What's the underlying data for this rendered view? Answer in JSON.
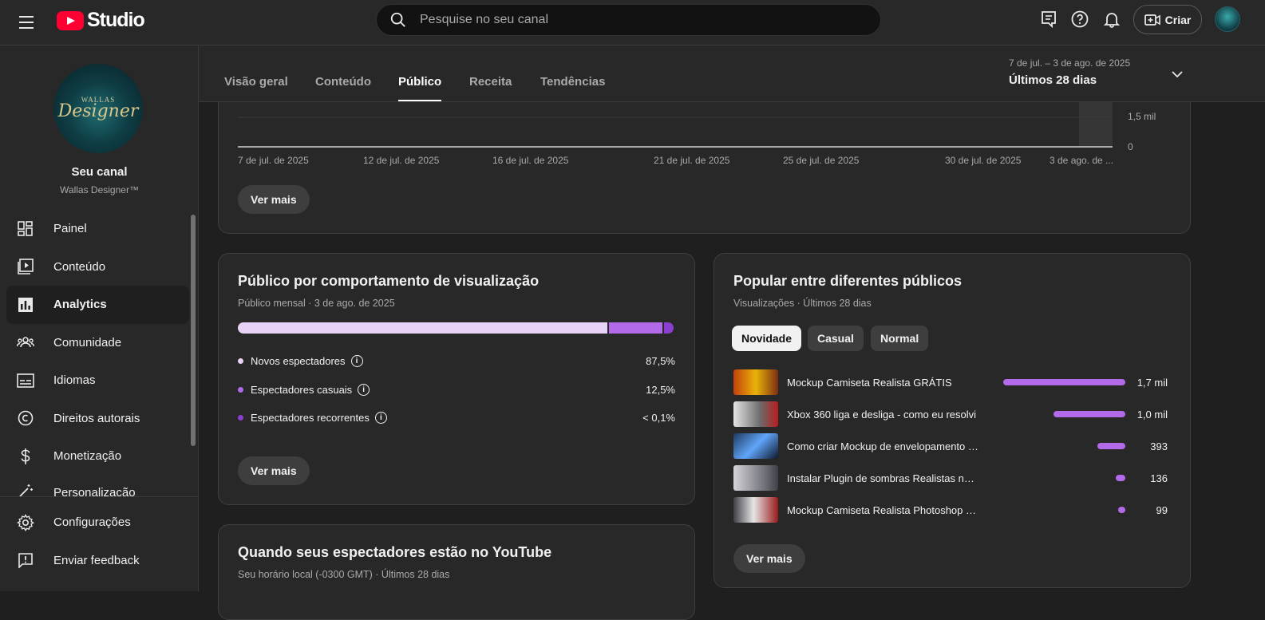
{
  "app": {
    "brand": "Studio"
  },
  "search": {
    "placeholder": "Pesquise no seu canal"
  },
  "topbar": {
    "create_label": "Criar"
  },
  "channel": {
    "avatar_line1": "WALLAS",
    "avatar_line2": "Designer",
    "title": "Seu canal",
    "name": "Wallas Designer™"
  },
  "sidebar": {
    "items": [
      {
        "label": "Painel",
        "icon": "dashboard-icon"
      },
      {
        "label": "Conteúdo",
        "icon": "content-icon"
      },
      {
        "label": "Analytics",
        "icon": "analytics-icon",
        "active": true
      },
      {
        "label": "Comunidade",
        "icon": "community-icon"
      },
      {
        "label": "Idiomas",
        "icon": "subtitles-icon"
      },
      {
        "label": "Direitos autorais",
        "icon": "copyright-icon"
      },
      {
        "label": "Monetização",
        "icon": "dollar-icon"
      },
      {
        "label": "Personalização",
        "icon": "magic-wand-icon"
      }
    ],
    "bottom": [
      {
        "label": "Configurações",
        "icon": "gear-icon"
      },
      {
        "label": "Enviar feedback",
        "icon": "feedback-icon"
      }
    ]
  },
  "tabs": [
    "Visão geral",
    "Conteúdo",
    "Público",
    "Receita",
    "Tendências"
  ],
  "active_tab": "Público",
  "daterange": {
    "range": "7 de jul. – 3 de ago. de 2025",
    "label": "Últimos 28 dias"
  },
  "top_chart": {
    "y_ticks": [
      "1,5 mil",
      "0"
    ],
    "x_ticks": [
      "7 de jul. de 2025",
      "12 de jul. de 2025",
      "16 de jul. de 2025",
      "21 de jul. de 2025",
      "25 de jul. de 2025",
      "30 de jul. de 2025",
      "3 de ago. de ..."
    ],
    "more_label": "Ver mais"
  },
  "behavior_card": {
    "title": "Público por comportamento de visualização",
    "subtitle": "Público mensal · 3 de ago. de 2025",
    "segments": [
      {
        "label": "Novos espectadores",
        "value": "87,5%",
        "fraction": 0.875,
        "color": "#e6d3f5"
      },
      {
        "label": "Espectadores casuais",
        "value": "12,5%",
        "fraction": 0.125,
        "color": "#b36ae8"
      },
      {
        "label": "Espectadores recorrentes",
        "value": "< 0,1%",
        "fraction": 0.001,
        "color": "#8b3fd1"
      }
    ],
    "more_label": "Ver mais"
  },
  "when_card": {
    "title": "Quando seus espectadores estão no YouTube",
    "subtitle": "Seu horário local (-0300 GMT) · Últimos 28 dias"
  },
  "popular_card": {
    "title": "Popular entre diferentes públicos",
    "subtitle": "Visualizações · Últimos 28 dias",
    "chips": [
      "Novidade",
      "Casual",
      "Normal"
    ],
    "selected_chip": "Novidade",
    "videos": [
      {
        "title": "Mockup Camiseta Realista GRÁTIS",
        "value": "1,7 mil",
        "views": 1700,
        "thumb": "#8a3d1f"
      },
      {
        "title": "Xbox 360 liga e desliga - como eu resolvi",
        "value": "1,0 mil",
        "views": 1000,
        "thumb": "#c9c9c9"
      },
      {
        "title": "Como criar Mockup de envelopamento de carros",
        "value": "393",
        "views": 393,
        "thumb": "#2c4e78"
      },
      {
        "title": "Instalar Plugin de sombras Realistas no Photoshop",
        "value": "136",
        "views": 136,
        "thumb": "#9aa3ad"
      },
      {
        "title": "Mockup Camiseta Realista Photoshop Profissional",
        "value": "99",
        "views": 99,
        "thumb": "#6a1c1c"
      }
    ],
    "max_views": 1700,
    "more_label": "Ver mais"
  }
}
